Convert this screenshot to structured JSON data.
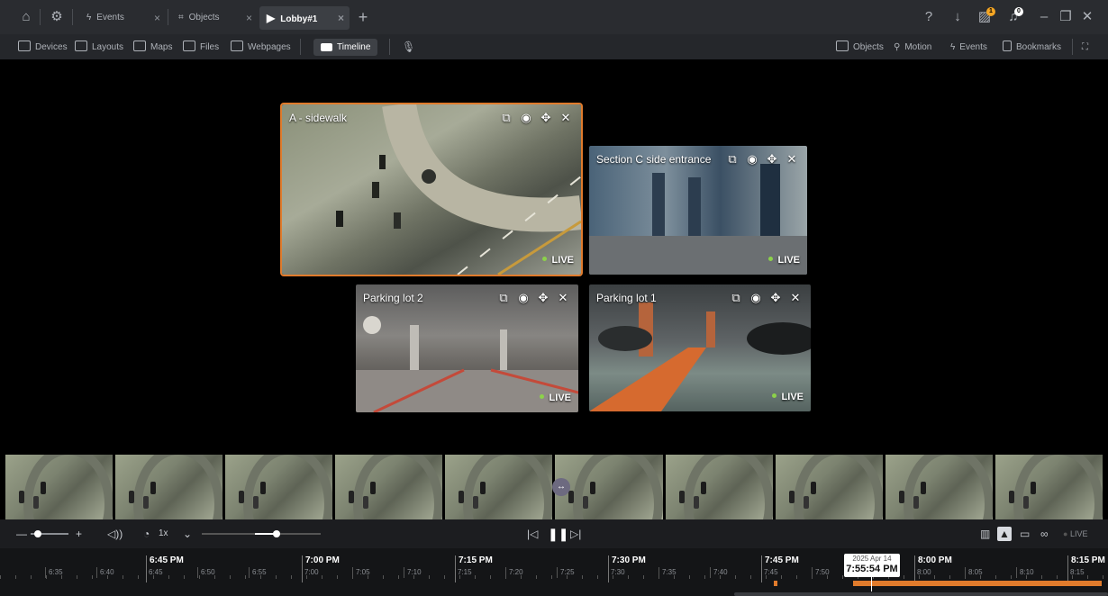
{
  "tabs": {
    "events": "Events",
    "objects": "Objects",
    "lobby": "Lobby#1",
    "close": "×",
    "add": "+"
  },
  "notifications": {
    "exports_badge": "1",
    "alerts_badge": "0"
  },
  "toolbar": {
    "devices": "Devices",
    "layouts": "Layouts",
    "maps": "Maps",
    "files": "Files",
    "webpages": "Webpages",
    "timeline": "Timeline",
    "objects": "Objects",
    "motion": "Motion",
    "events": "Events",
    "bookmarks": "Bookmarks"
  },
  "cameras": [
    {
      "title": "A - sidewalk",
      "status": "LIVE"
    },
    {
      "title": "Section C side entrance",
      "status": "LIVE"
    },
    {
      "title": "Parking lot 2",
      "status": "LIVE"
    },
    {
      "title": "Parking lot 1",
      "status": "LIVE"
    }
  ],
  "controls": {
    "speed": "1x",
    "live": "LIVE"
  },
  "timeline": {
    "majors": [
      "6:45 PM",
      "7:00 PM",
      "7:15 PM",
      "7:30 PM",
      "7:45 PM",
      "8:00 PM",
      "8:15 PM"
    ],
    "minors": [
      "6:35",
      "6:40",
      "6:45",
      "6:50",
      "6:55",
      "7:00",
      "7:05",
      "7:10",
      "7:15",
      "7:20",
      "7:25",
      "7:30",
      "7:35",
      "7:40",
      "7:45",
      "7:50",
      "8:00",
      "8:05",
      "8:10",
      "8:15"
    ],
    "cursor_date": "2025 Apr 14",
    "cursor_time": "7:55:54 PM"
  },
  "colors": {
    "accent": "#e07b2c",
    "live_dot": "#8cd24a",
    "badge": "#f5a623"
  }
}
